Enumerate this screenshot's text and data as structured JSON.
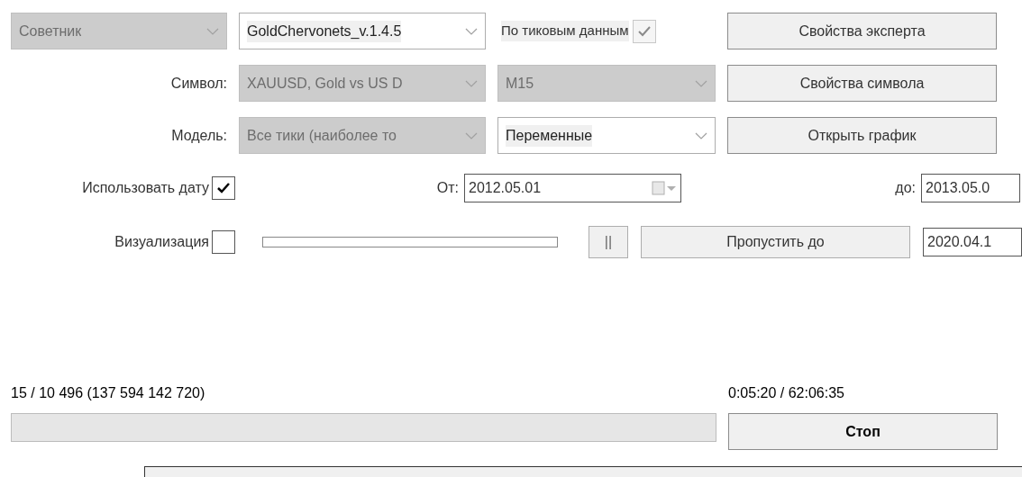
{
  "expert": {
    "type": {
      "value": "Советник",
      "disabled": true
    },
    "name": {
      "value": "GoldChervonets_v.1.4.5",
      "disabled": false
    },
    "tick_data": {
      "label": "По тиковым данным",
      "checked": true,
      "disabled": true
    },
    "button": "Свойства эксперта"
  },
  "symbol": {
    "label": "Символ:",
    "value": "XAUUSD, Gold vs US D",
    "disabled": true,
    "period": {
      "value": "M15",
      "disabled": true
    },
    "button": "Свойства символа"
  },
  "model": {
    "label": "Модель:",
    "value": "Все тики (наиболее то",
    "disabled": true,
    "inputs": {
      "value": "Переменные",
      "disabled": false
    },
    "button": "Открыть график"
  },
  "use_date": {
    "label": "Использовать дату",
    "checked": true,
    "from_label": "От:",
    "from": "2012.05.01",
    "to_label": "до:",
    "to": "2013.05.0"
  },
  "visualization": {
    "label": "Визуализация",
    "checked": false,
    "level": 0,
    "pause": "||",
    "skip_button": "Пропустить до",
    "skip_date": "2020.04.1"
  },
  "status": {
    "progress_text": "15 / 10 496 (137 594 142 720)",
    "time": "0:05:20 / 62:06:35",
    "level": 0,
    "stop_button": "Стоп"
  }
}
